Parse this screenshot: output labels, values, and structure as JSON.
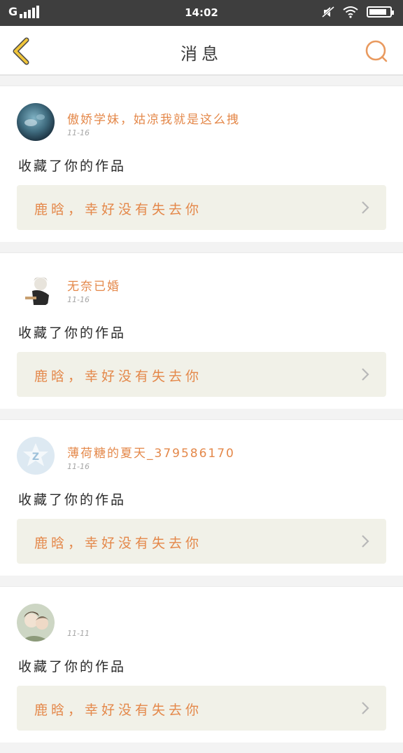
{
  "status_bar": {
    "carrier": "G",
    "time": "14:02",
    "battery_level": 0.85,
    "icons": [
      "signal-icon",
      "mute-icon",
      "wifi-icon",
      "battery-icon"
    ]
  },
  "header": {
    "title": "消息",
    "back_icon": "chevron-left-icon",
    "search_icon": "search-icon"
  },
  "colors": {
    "accent": "#e4884a",
    "back_arrow": "#f0c53a",
    "status_bar_bg": "#3e3e3e",
    "card_inner_bg": "#f1f1e8"
  },
  "messages": [
    {
      "username": "傲娇学妹，姑凉我就是这么拽",
      "date": "11-16",
      "action": "收藏了你的作品",
      "work_title": "鹿晗，幸好没有失去你",
      "avatar": "avatar-photo"
    },
    {
      "username": "无奈已婚",
      "date": "11-16",
      "action": "收藏了你的作品",
      "work_title": "鹿晗，幸好没有失去你",
      "avatar": "avatar-anime"
    },
    {
      "username": "薄荷糖的夏天_379586170",
      "date": "11-16",
      "action": "收藏了你的作品",
      "work_title": "鹿晗，幸好没有失去你",
      "avatar": "avatar-default-z"
    },
    {
      "username": "",
      "date": "11-11",
      "action": "收藏了你的作品",
      "work_title": "鹿晗，幸好没有失去你",
      "avatar": "avatar-anime-couple"
    }
  ]
}
